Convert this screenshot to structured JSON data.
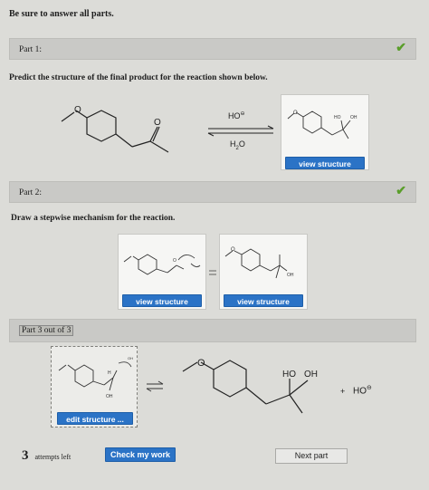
{
  "intro": "Be sure to answer all parts.",
  "part1": {
    "label": "Part 1:",
    "question": "Predict the structure of the final product for the reaction shown below.",
    "reagent_top": "HO",
    "reagent_bottom": "H2O",
    "product_labels": [
      "HO",
      "OH"
    ],
    "view_button": "view structure"
  },
  "part2": {
    "label": "Part 2:",
    "question": "Draw a stepwise mechanism for the reaction.",
    "view_button_1": "view structure",
    "view_button_2": "view structure",
    "oh_label": "OH"
  },
  "part3": {
    "label": "Part 3 out of 3",
    "edit_button": "edit structure ...",
    "product_ho": "HO",
    "product_oh": "OH",
    "plus": "+",
    "hydroxide": "HO"
  },
  "footer": {
    "attempts_number": "3",
    "attempts_text": "attempts left",
    "check_button": "Check my work",
    "next_button": "Next part"
  },
  "colors": {
    "check": "#5a9e2a",
    "button_blue": "#2b73c6"
  }
}
